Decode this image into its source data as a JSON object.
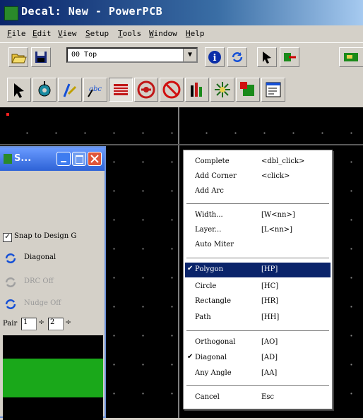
{
  "window": {
    "title": "Decal: New - PowerPCB"
  },
  "menu": [
    "File",
    "Edit",
    "View",
    "Setup",
    "Tools",
    "Window",
    "Help"
  ],
  "toolbar": {
    "layer_value": "00 Top"
  },
  "float_window": {
    "title": "S...",
    "snap_label": "Snap to Design G",
    "snap_checked": true,
    "diagonal_label": "Diagonal",
    "drc_label": "DRC Off",
    "nudge_label": "Nudge Off",
    "pair_label": "Pair",
    "pair_value1": "1",
    "pair_value2": "2"
  },
  "context_menu": {
    "items": [
      {
        "label": "Complete",
        "shortcut": "<dbl_click>"
      },
      {
        "label": "Add Corner",
        "shortcut": "<click>"
      },
      {
        "label": "Add Arc",
        "shortcut": ""
      },
      {
        "label": "Width...",
        "shortcut": "[W<nn>]"
      },
      {
        "label": "Layer...",
        "shortcut": "[L<nn>]"
      },
      {
        "label": "Auto Miter",
        "shortcut": ""
      },
      {
        "label": "Polygon",
        "shortcut": "[HP]",
        "checked": true,
        "selected": true
      },
      {
        "label": "Circle",
        "shortcut": "[HC]"
      },
      {
        "label": "Rectangle",
        "shortcut": "[HR]"
      },
      {
        "label": "Path",
        "shortcut": "[HH]"
      },
      {
        "label": "Orthogonal",
        "shortcut": "[AO]"
      },
      {
        "label": "Diagonal",
        "shortcut": "[AD]",
        "checked": true
      },
      {
        "label": "Any Angle",
        "shortcut": "[AA]"
      },
      {
        "label": "Cancel",
        "shortcut": "Esc"
      }
    ]
  },
  "colors": {
    "title_bar": "#0a246a",
    "canvas": "#000000",
    "selection": "#0a246a",
    "fill": "#1aa81a"
  }
}
